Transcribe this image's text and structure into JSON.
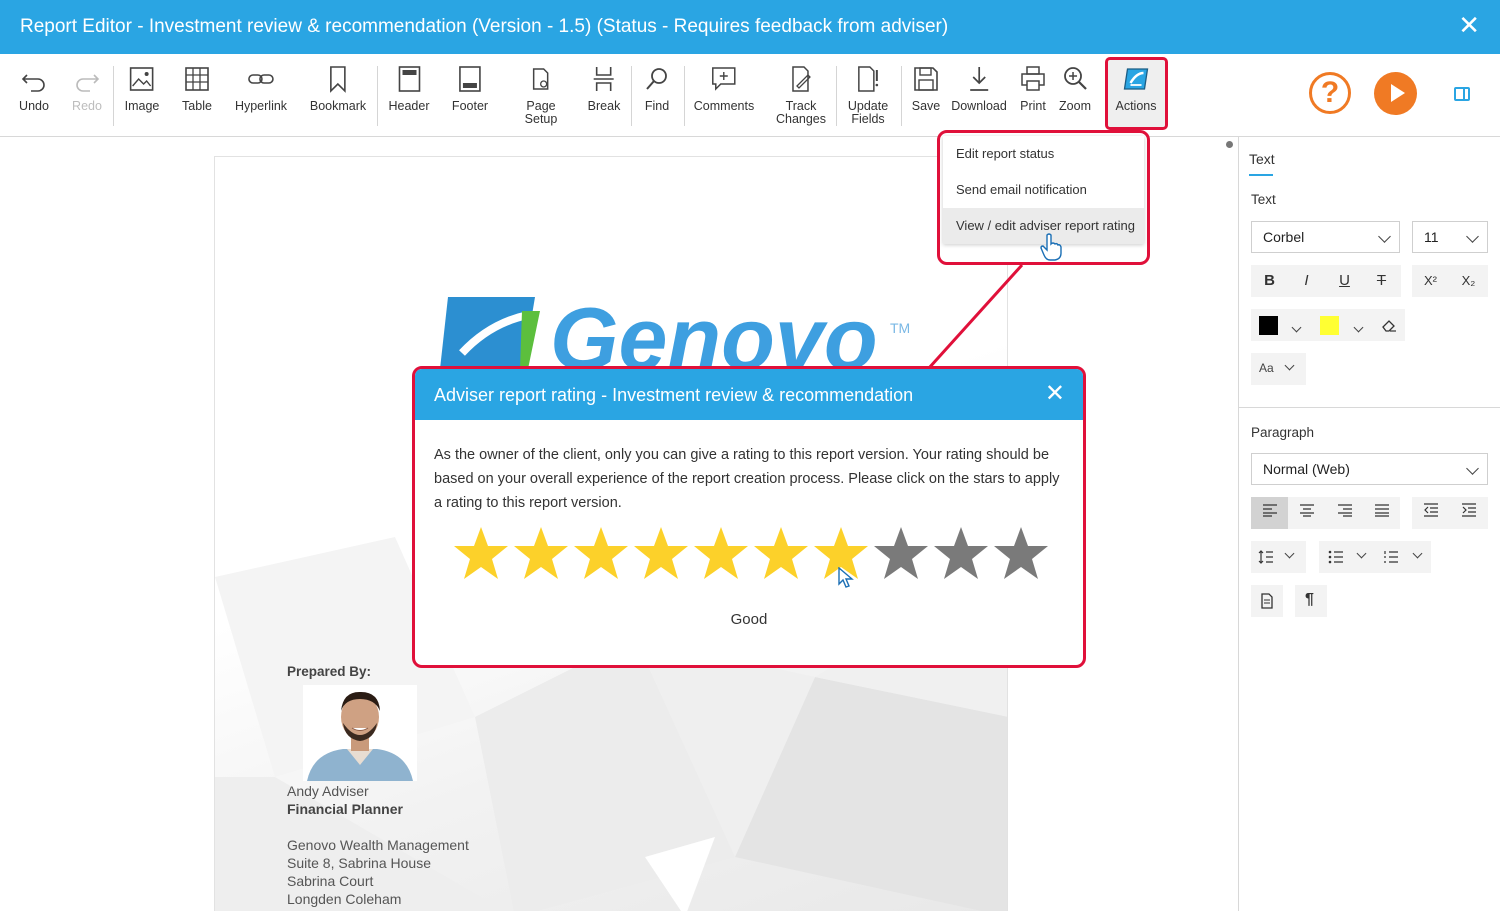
{
  "window": {
    "title": "Report Editor - Investment review & recommendation (Version - 1.5) (Status - Requires feedback from adviser)",
    "close_glyph": "✕"
  },
  "toolbar": {
    "undo": "Undo",
    "redo": "Redo",
    "image": "Image",
    "table": "Table",
    "hyperlink": "Hyperlink",
    "bookmark": "Bookmark",
    "header": "Header",
    "footer": "Footer",
    "page_setup_1": "Page",
    "page_setup_2": "Setup",
    "break": "Break",
    "find": "Find",
    "comments": "Comments",
    "track_changes_1": "Track",
    "track_changes_2": "Changes",
    "update_fields_1": "Update",
    "update_fields_2": "Fields",
    "save": "Save",
    "download": "Download",
    "print": "Print",
    "zoom": "Zoom",
    "actions": "Actions",
    "help_glyph": "?"
  },
  "actions_menu": {
    "items": [
      {
        "label": "Edit report status"
      },
      {
        "label": "Send email notification"
      },
      {
        "label": "View / edit adviser report rating"
      }
    ]
  },
  "document": {
    "logo_text": "Genovo",
    "logo_tm": "TM",
    "prepared_by": "Prepared By:",
    "adviser_name": "Andy Adviser",
    "adviser_role": "Financial Planner",
    "address": [
      "Genovo Wealth Management",
      "Suite 8, Sabrina House",
      "Sabrina Court",
      "Longden Coleham"
    ]
  },
  "rating_dialog": {
    "title": "Adviser report rating - Investment review & recommendation",
    "close_glyph": "✕",
    "body": "As the owner of the client, only you can give a rating to this report version. Your rating should be based on your overall experience of the report creation process. Please click on the stars to apply a rating to this report version.",
    "max_stars": 10,
    "rating": 7,
    "rating_label": "Good",
    "star_filled_color": "#fcd12a",
    "star_empty_color": "#7a7a7a"
  },
  "format_panel": {
    "tab": "Text",
    "text_section": "Text",
    "font_family": "Corbel",
    "font_size": "11",
    "bold": "B",
    "italic": "I",
    "underline": "U",
    "strike": "T",
    "superscript": "X²",
    "subscript": "X₂",
    "font_color": "#000000",
    "highlight_color": "#ffff33",
    "case": "Aa",
    "paragraph_section": "Paragraph",
    "paragraph_style": "Normal (Web)",
    "pilcrow": "¶"
  },
  "colors": {
    "accent": "#2aa5e3",
    "highlight_border": "#e0103a",
    "help_orange": "#f07a24"
  }
}
